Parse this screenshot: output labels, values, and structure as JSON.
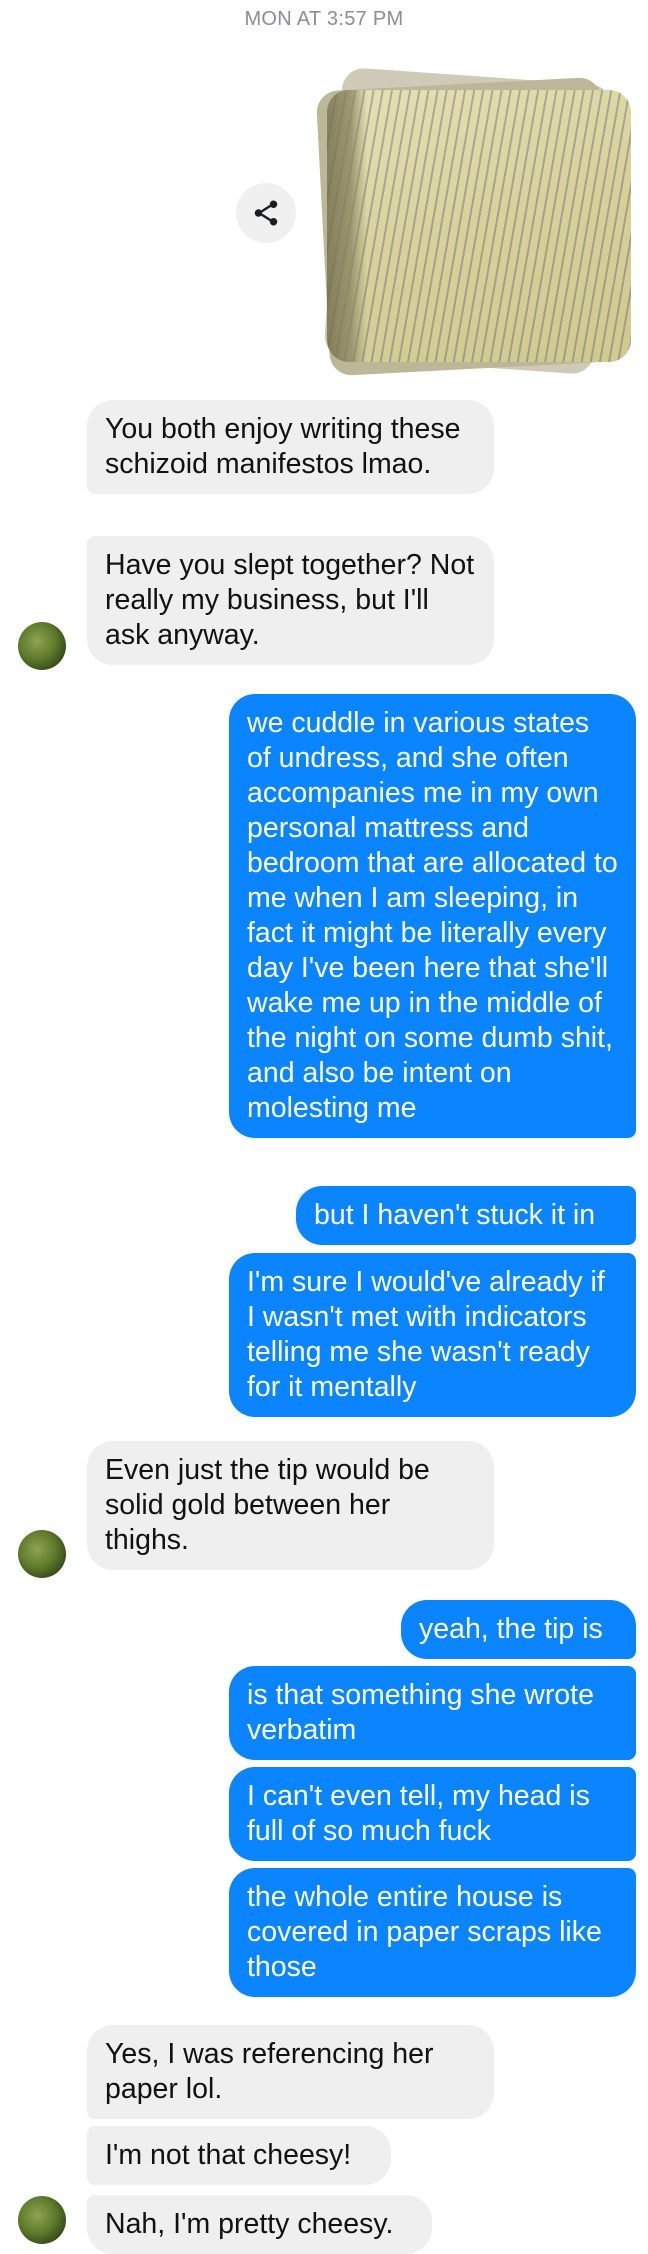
{
  "header": {
    "timestamp": "MON AT 3:57 PM"
  },
  "messages": [
    {
      "from": "them",
      "text": "You both enjoy writing these schizoid manifestos lmao."
    },
    {
      "from": "them",
      "text": "Have you slept together? Not really my business, but I'll ask anyway."
    },
    {
      "from": "me",
      "text": "we cuddle in various states of undress, and she often accompanies me in my own personal mattress and bedroom that are allocated to me when I am sleeping, in fact it might be literally every day I've been here that she'll wake me up in the middle of the night on some dumb shit, and also be intent on molesting me"
    },
    {
      "from": "me",
      "text": "but I haven't stuck it in"
    },
    {
      "from": "me",
      "text": "I'm sure I would've already if I wasn't met with indicators telling me she wasn't ready for it mentally"
    },
    {
      "from": "them",
      "text": "Even just the tip would be solid gold between her thighs."
    },
    {
      "from": "me",
      "text": "yeah, the tip is"
    },
    {
      "from": "me",
      "text": "is that something she wrote verbatim"
    },
    {
      "from": "me",
      "text": "I can't even tell, my head is full of so much fuck"
    },
    {
      "from": "me",
      "text": "the whole entire house is covered in paper scraps like those"
    },
    {
      "from": "them",
      "text": "Yes, I was referencing her paper lol."
    },
    {
      "from": "them",
      "text": "I'm not that cheesy!"
    },
    {
      "from": "them",
      "text": "Nah, I'm pretty cheesy."
    }
  ],
  "icons": {
    "share": "share-icon"
  },
  "colors": {
    "outgoing": "#0a84ff",
    "incoming": "#efefef",
    "timestamp": "#8a8d91"
  }
}
